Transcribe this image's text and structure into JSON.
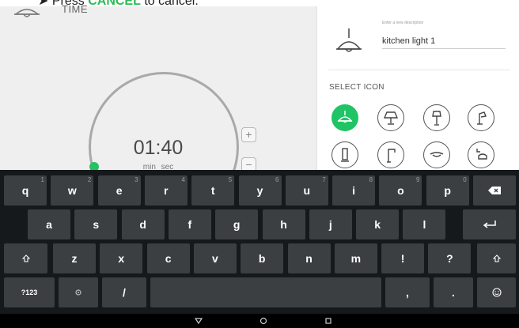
{
  "instruction": {
    "bullet": "➤",
    "prefix": "Press ",
    "cancel_word": "CANCEL",
    "suffix": " to cancel."
  },
  "timer": {
    "label": "TIME",
    "value": "01:40",
    "units": "min sec",
    "plus": "+",
    "minus": "−"
  },
  "description": {
    "hint": "Enter a new description",
    "value": "kitchen light 1"
  },
  "select_icon": {
    "title": "SELECT ICON"
  },
  "icons": [
    "pendant-lamp-icon",
    "table-lamp-icon",
    "floor-lamp-icon",
    "desk-lamp-icon",
    "tube-lamp-icon",
    "street-lamp-icon",
    "ceiling-lamp-icon",
    "hanging-lamp-icon"
  ],
  "keyboard": {
    "row1": [
      {
        "k": "q",
        "s": "1"
      },
      {
        "k": "w",
        "s": "2"
      },
      {
        "k": "e",
        "s": "3"
      },
      {
        "k": "r",
        "s": "4"
      },
      {
        "k": "t",
        "s": "5"
      },
      {
        "k": "y",
        "s": "6"
      },
      {
        "k": "u",
        "s": "7"
      },
      {
        "k": "i",
        "s": "8"
      },
      {
        "k": "o",
        "s": "9"
      },
      {
        "k": "p",
        "s": "0"
      }
    ],
    "row2": [
      "a",
      "s",
      "d",
      "f",
      "g",
      "h",
      "j",
      "k",
      "l"
    ],
    "row3": [
      "z",
      "x",
      "c",
      "v",
      "b",
      "n",
      "m",
      "!",
      "?"
    ],
    "sym_key": "?123",
    "slash": "/",
    "comma": ",",
    "period": "."
  },
  "colors": {
    "accent": "#1fc464",
    "keyboard_bg": "#16191c",
    "key_bg": "#3b3f42"
  }
}
